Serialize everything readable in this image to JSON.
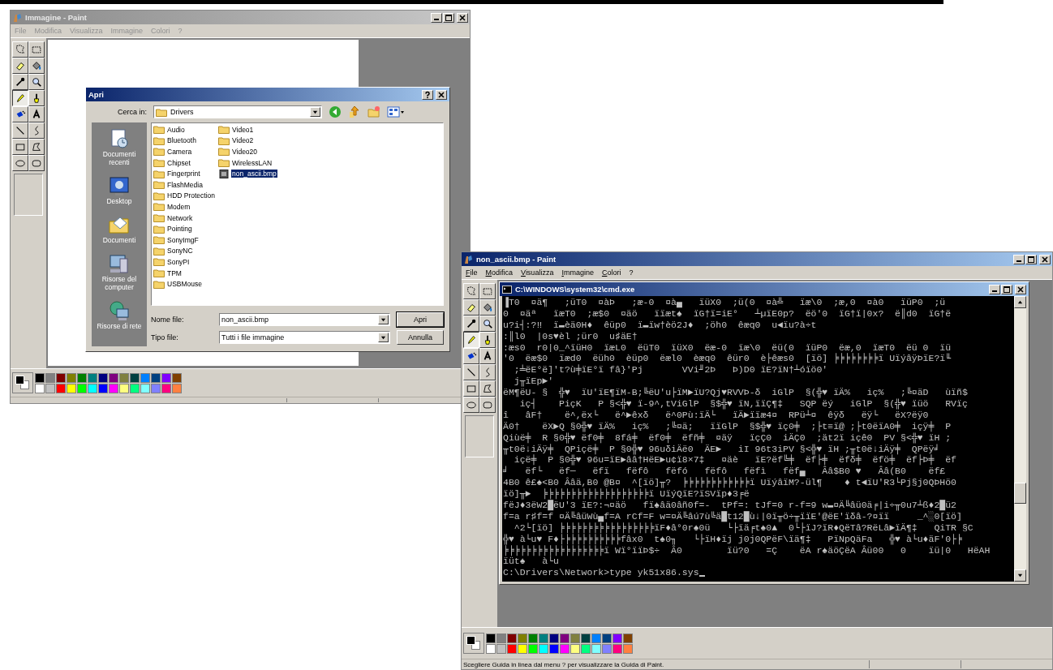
{
  "windows": [
    {
      "title": "Immagine - Paint",
      "active": false,
      "menu": [
        "File",
        "Modifica",
        "Visualizza",
        "Immagine",
        "Colori",
        "?"
      ],
      "tools": [
        {
          "selected": false
        },
        {
          "selected": false
        },
        {
          "selected": false
        },
        {
          "selected": false
        },
        {
          "selected": false
        },
        {
          "selected": false
        },
        {
          "selected": true
        },
        {
          "selected": false
        },
        {
          "selected": false
        },
        {
          "selected": false
        },
        {
          "selected": false
        },
        {
          "selected": false
        },
        {
          "selected": false
        },
        {
          "selected": false
        },
        {
          "selected": false
        },
        {
          "selected": false
        }
      ],
      "content": {
        "kind": "file-dialog"
      }
    },
    {
      "title": "non_ascii.bmp - Paint",
      "active": true,
      "menu": [
        "File",
        "Modifica",
        "Visualizza",
        "Immagine",
        "Colori",
        "?"
      ],
      "tools": [
        {
          "selected": false
        },
        {
          "selected": false
        },
        {
          "selected": false
        },
        {
          "selected": false
        },
        {
          "selected": false
        },
        {
          "selected": false
        },
        {
          "selected": true
        },
        {
          "selected": false
        },
        {
          "selected": false
        },
        {
          "selected": false
        },
        {
          "selected": false
        },
        {
          "selected": false
        },
        {
          "selected": false
        },
        {
          "selected": false
        },
        {
          "selected": false
        },
        {
          "selected": false
        }
      ],
      "content": {
        "kind": "console"
      },
      "status_text": "Scegliere Guida in linea dal menu ? per visualizzare la Guida di Paint."
    }
  ],
  "palette": {
    "swatches": [
      {
        "color": "#000000"
      },
      {
        "color": "#808080"
      },
      {
        "color": "#800000"
      },
      {
        "color": "#808000"
      },
      {
        "color": "#008000"
      },
      {
        "color": "#008080"
      },
      {
        "color": "#000080"
      },
      {
        "color": "#800080"
      },
      {
        "color": "#808040"
      },
      {
        "color": "#004040"
      },
      {
        "color": "#0080ff"
      },
      {
        "color": "#004080"
      },
      {
        "color": "#8000ff"
      },
      {
        "color": "#804000"
      },
      {
        "color": "#ffffff"
      },
      {
        "color": "#c0c0c0"
      },
      {
        "color": "#ff0000"
      },
      {
        "color": "#ffff00"
      },
      {
        "color": "#00ff00"
      },
      {
        "color": "#00ffff"
      },
      {
        "color": "#0000ff"
      },
      {
        "color": "#ff00ff"
      },
      {
        "color": "#ffff80"
      },
      {
        "color": "#00ff80"
      },
      {
        "color": "#80ffff"
      },
      {
        "color": "#8080ff"
      },
      {
        "color": "#ff0080"
      },
      {
        "color": "#ff8040"
      }
    ]
  },
  "dialog": {
    "title": "Apri",
    "look_in_label": "Cerca in:",
    "look_in_value": "Drivers",
    "places": [
      "Documenti recenti",
      "Desktop",
      "Documenti",
      "Risorse del computer",
      "Risorse di rete"
    ],
    "files": [
      {
        "name": "Audio",
        "kind": "folder",
        "selected": false
      },
      {
        "name": "Bluetooth",
        "kind": "folder",
        "selected": false
      },
      {
        "name": "Camera",
        "kind": "folder",
        "selected": false
      },
      {
        "name": "Chipset",
        "kind": "folder",
        "selected": false
      },
      {
        "name": "Fingerprint",
        "kind": "folder",
        "selected": false
      },
      {
        "name": "FlashMedia",
        "kind": "folder",
        "selected": false
      },
      {
        "name": "HDD Protection",
        "kind": "folder",
        "selected": false
      },
      {
        "name": "Modem",
        "kind": "folder",
        "selected": false
      },
      {
        "name": "Network",
        "kind": "folder",
        "selected": false
      },
      {
        "name": "Pointing",
        "kind": "folder",
        "selected": false
      },
      {
        "name": "SonyImgF",
        "kind": "folder",
        "selected": false
      },
      {
        "name": "SonyNC",
        "kind": "folder",
        "selected": false
      },
      {
        "name": "SonyPI",
        "kind": "folder",
        "selected": false
      },
      {
        "name": "TPM",
        "kind": "folder",
        "selected": false
      },
      {
        "name": "USBMouse",
        "kind": "folder",
        "selected": false
      },
      {
        "name": "Video1",
        "kind": "folder",
        "selected": false
      },
      {
        "name": "Video2",
        "kind": "folder",
        "selected": false
      },
      {
        "name": "Video20",
        "kind": "folder",
        "selected": false
      },
      {
        "name": "WirelessLAN",
        "kind": "folder",
        "selected": false
      },
      {
        "name": "non_ascii.bmp",
        "kind": "image",
        "selected": true
      }
    ],
    "filename_label": "Nome file:",
    "filename_value": "non_ascii.bmp",
    "filetype_label": "Tipo file:",
    "filetype_value": "Tutti i file immagine",
    "open_button": "Apri",
    "cancel_button": "Annulla"
  },
  "console": {
    "title": "C:\\WINDOWS\\system32\\cmd.exe",
    "lines": [
      "▐T0  ¤ä¶   ;üT0  ¤àÞ   ;æ-0  ¤à▄   ïüX0  ;ü(0  ¤à╩   ïæ\\0  ;æ,0  ¤à0   ïüP0  ;ü",
      "0  ¤äª   ïæT0  ;æ$0  ¤äö   ïïæt♠  ïG†ï=iE°   ┴µïE0p?  ëö'0  ïG†ï|0x?  ë║d0  ïG†ë",
      "u?i┤:?‼  ï▬èä0H♦  êüp0  ï▬ïw†èö2J♦  ;öh0  êæq0  u◄ïu?à÷t",
      ":║l0  |0s♥èl ;ür0  u♯äE†",
      ":æs0  r0|0_^ïüH0  ïæL0  ëüT0  ïüX0  ëæ-0  ïæ\\0  ëü(0  ïüP0  ëæ,0  ïæT0  ëü 0  ïü",
      "'0  ëæ$0  ïæd0  ëüh0  èüp0  ëæl0  èæq0  êür0  è├êæs0  [ïö] ╞╞╞╞╞╞╞╞ï UïýâÿÞïE?ï╙",
      "  ;╧ëE°ë]'t?ù╪ïE°ï fâ}'Pj       VVi╜2Þ   Þ)D0 ïE?ïN†┴óïö0'",
      "  j╥ïEp►'",
      "ëM¶ëU- §  ╬♥  ïU'ïE¶ïM-B;╚ëU'u├ïM►ïU?Qj♥RVVÞ-δ  iGlP  §(╬♥ ïÄ%   iç%   ;╚¤äD   ùïñ$",
      "   iç┤    PiçK   P §<╬♥ ï-9^,tViGlP  §$╬♥ ïN,ïïÇ¶‡   SQP ëý   iGlP  §(╬♥ ïüö   RVïç",
      "î   âF†    ë^,ëx└   ë^►êxδ   ë^0Pù:ïÄ└   ïÄ►ïïæ4¤  RPü┴¤  êÿδ   ëÿ└   ëX?ëÿ0",
      "Ä0†    ëX►Q §0╬♥ ïÄ%   iç%   ;╚¤ä;   ïïGlP  §$╬♥ ïç0╪  ;├t≡ï@ ;├t0ëïA0╪  içÿ╪  P",
      "Qiùë╪  R §0╬♥ ëf0╪  8fá╪  ëf0╪  ëfñ╪  ¤äÿ   ïçÇ0  iÄÇ0  ;ät2ï içê0  PV §<╬♥ ïH ;",
      "╥t0ë↓iÄÿ╪  QPiçë╪  P §0╬♥ 96uδiÄë0  ÄE►   iI 96t3iPV §<╬♥ ïH ;╥t0ë↓iÄÿ╪  QPëÿ╛",
      "  içë╪  P §0╬♥ 96u=ïE►ââ†HëE►u¢ï8×7‡   ¤äè   ïE?ëf╚╪  ëf├╪  ëfδ╪  ëfö╪  ëf├Þ╪  ëf",
      "╛   ëf└   ëf─   ëfï   fëfô   fëfó   fëfô   fëfì   fëf▄   Ââ$B0 ♥   Ââ(B0    ëf£",
      "4B0 ê£♠<B0 Ââä,B0 @B¤  ^[ïö]╥?  ╞╞╞╞╞╞╞╞╞╞╞╞ï UïýâïM?-ül¶    ♦ t◄ïU'R3└Pj§j0QÞHö0",
      "ïö]╥►  ╞╞╞╞╞╞╞╞╞╞╞╞╞╞╞╞╞╞╞ï UïýQïE?ïSVïp♦3╒ë",
      "fëJ♦3ëW2█ëU'3 ïE?:¬¤äö   fï♠âä0âñ0f=-  tPf=: tJf=0 r-f=9 w▬¤Ä╚âü0ä╒|i÷╥0u7┴ß♦2█ü2",
      "f=a r♯f=f ¤Ä╚âüWù▄f=A rCf=F w=¤Ä╚âú7ù╚ä█t12█ù↓|0ï╥ö÷╥ïïE'@ëE'ïδâ-?¤ïï     _^░0[ïö]",
      "  ^2└[ïö] ╞╞╞╞╞╞╞╞╞╞╞╞╞╞╞╞╞ïF♦â°0r♠0ü   └├ïä╒t♠0▲  0└├ïJ?ïR♦QëTâ?RëLâ►ïÄ¶‡   QiTR §C",
      "╬♥ à└u♥ F♦├╞╞╞╞╞╞╞╞╞╞fâx0  t♠0╖   └├ïH♦ïj j0j0QPëF\\ïä¶‡   PïNpQäFa   ╬♥ à└u♦äF'0├╞",
      "╞╞╞╞╞╞╞╞╞╞╞╞╞╞╞╞╞╞ï Wï°ïïÞ$÷  Â0        ïü?0   =Ç    ëA r♠äöÇëA Âü00   0    ïü|0   HëAH",
      "ïüt♠   à└u",
      "C:\\Drivers\\Network>type yk51x86.sys"
    ]
  }
}
